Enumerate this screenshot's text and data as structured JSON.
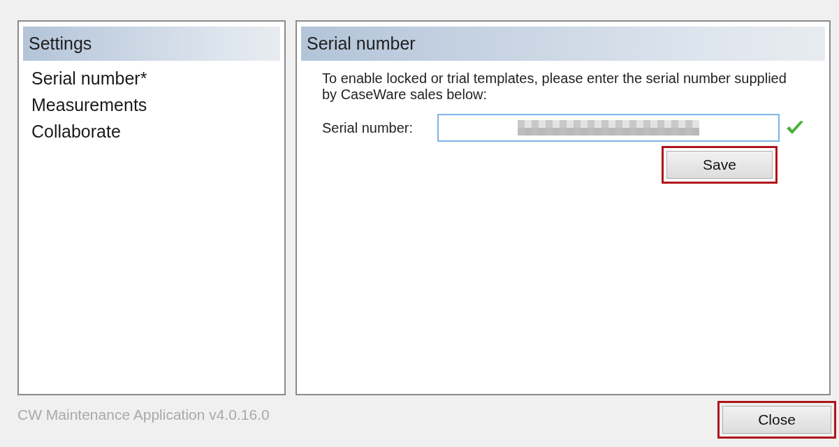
{
  "sidebar": {
    "title": "Settings",
    "items": [
      {
        "label": "Serial number*",
        "selected": false
      },
      {
        "label": "Measurements",
        "selected": false
      },
      {
        "label": "Collaborate",
        "selected": false
      }
    ]
  },
  "panel": {
    "title": "Serial number",
    "description": "To enable locked or trial templates, please enter the serial number supplied by CaseWare sales below:",
    "field": {
      "label": "Serial number:",
      "valid": true
    },
    "save_button": {
      "label": "Save",
      "highlighted": true
    }
  },
  "footer": {
    "version": "CW Maintenance Application v4.0.16.0",
    "close_button": {
      "label": "Close",
      "highlighted": true
    }
  }
}
